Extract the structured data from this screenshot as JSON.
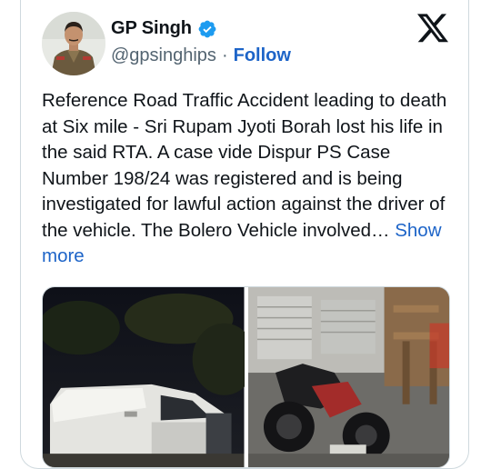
{
  "author": {
    "display_name": "GP Singh",
    "handle": "@gpsinghips",
    "separator": "·",
    "follow_label": "Follow"
  },
  "platform_logo": "x-logo-icon",
  "verified_badge_color": "#1d9bf0",
  "accent_color": "#1d64c8",
  "tweet": {
    "text": "Reference Road Traffic Accident leading to death at Six mile - Sri Rupam Jyoti Borah lost his life in the said RTA. A case vide Dispur PS Case Number 198/24 was registered and is being investigated for lawful action against the driver of the vehicle. The Bolero Vehicle involved…",
    "show_more_label": "Show more"
  },
  "media": [
    {
      "name": "overturned-vehicle-photo"
    },
    {
      "name": "motorcycle-photo"
    }
  ]
}
